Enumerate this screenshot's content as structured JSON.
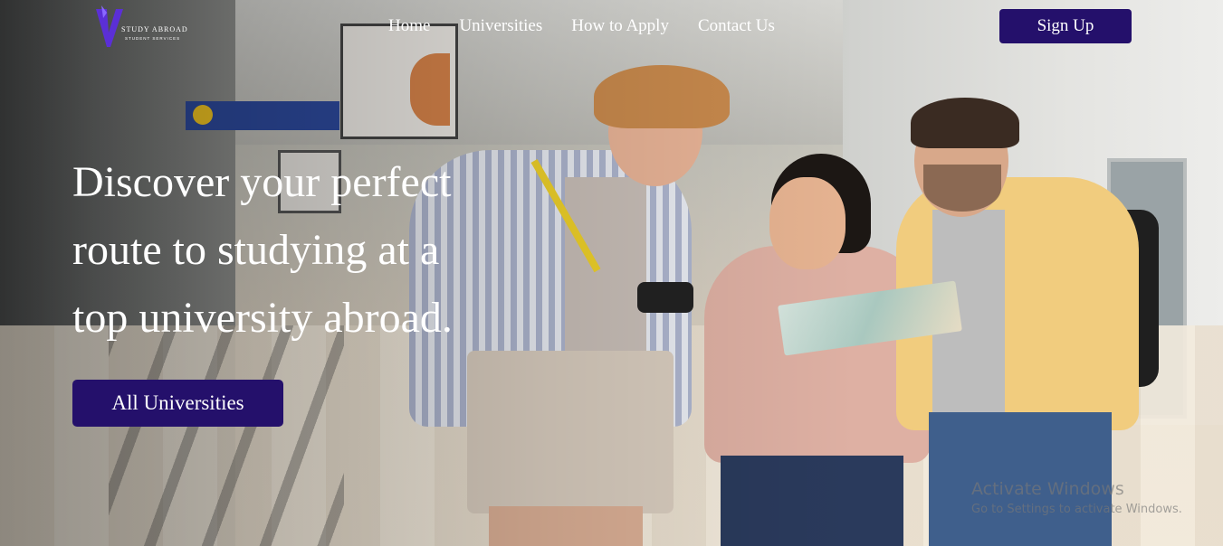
{
  "brand": {
    "logo_text": "STUDY ABROAD",
    "logo_subtext": "STUDENT SERVICES",
    "logo_color": "#5b2fd6"
  },
  "nav": {
    "items": [
      {
        "label": "Home"
      },
      {
        "label": "Universities"
      },
      {
        "label": "How to Apply"
      },
      {
        "label": "Contact Us"
      }
    ],
    "signup_label": "Sign Up"
  },
  "hero": {
    "headline": "Discover your perfect route to studying at a top university abroad.",
    "cta_label": "All Universities"
  },
  "watermark": {
    "line1": "Activate Windows",
    "line2": "Go to Settings to activate Windows."
  },
  "colors": {
    "primary_button": "#24106b",
    "text_on_hero": "#ffffff"
  }
}
